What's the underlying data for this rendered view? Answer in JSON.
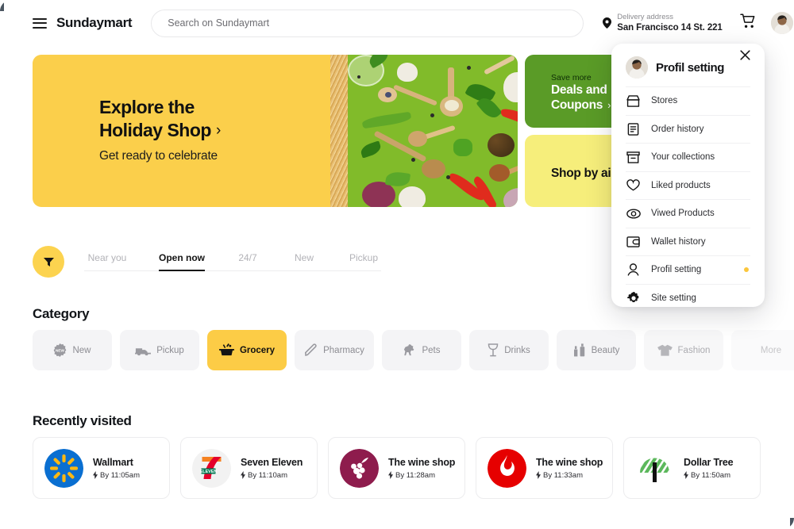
{
  "header": {
    "menu_icon": "hamburger-icon",
    "brand": "Sundaymart",
    "search": {
      "placeholder": "Search on Sundaymart",
      "value": ""
    },
    "delivery": {
      "label": "Delivery address",
      "value": "San Francisco 14 St. 221",
      "icon": "location-pin-icon"
    },
    "cart_icon": "shopping-cart-icon",
    "avatar": "user-avatar"
  },
  "hero": {
    "title_line1": "Explore the",
    "title_line2": "Holiday Shop",
    "chevron": "›",
    "subtitle": "Get ready to celebrate"
  },
  "promos": [
    {
      "small": "Save more",
      "big_line1": "Deals and",
      "big_line2": "Coupons",
      "chevron": "›",
      "color": "#5a9b27"
    },
    {
      "big_line1": "Shop by aisle",
      "chevron": "›",
      "color": "#f6ee7b"
    }
  ],
  "filters": {
    "filter_icon": "funnel-filter-icon",
    "tabs": [
      {
        "label": "Near you",
        "active": false
      },
      {
        "label": "Open now",
        "active": true
      },
      {
        "label": "24/7",
        "active": false
      },
      {
        "label": "New",
        "active": false
      },
      {
        "label": "Pickup",
        "active": false
      }
    ]
  },
  "category": {
    "title": "Category",
    "items": [
      {
        "label": "New",
        "icon": "new-badge-icon",
        "state": "normal"
      },
      {
        "label": "Pickup",
        "icon": "pickup-truck-icon",
        "state": "normal"
      },
      {
        "label": "Grocery",
        "icon": "grocery-basket-icon",
        "state": "active"
      },
      {
        "label": "Pharmacy",
        "icon": "pharmacy-pen-icon",
        "state": "normal"
      },
      {
        "label": "Pets",
        "icon": "pets-dog-icon",
        "state": "normal"
      },
      {
        "label": "Drinks",
        "icon": "drinks-glass-icon",
        "state": "normal"
      },
      {
        "label": "Beauty",
        "icon": "beauty-cosmetics-icon",
        "state": "normal"
      },
      {
        "label": "Fashion",
        "icon": "fashion-tshirt-icon",
        "state": "fade1"
      },
      {
        "label": "More",
        "icon": "",
        "state": "fade2"
      }
    ]
  },
  "recently_visited": {
    "title": "Recently visited",
    "items": [
      {
        "name": "Wallmart",
        "time": "By 11:05am",
        "logo": "walmart-logo"
      },
      {
        "name": "Seven Eleven",
        "time": "By 11:10am",
        "logo": "seven-eleven-logo"
      },
      {
        "name": "The wine shop",
        "time": "By 11:28am",
        "logo": "wine-shop-logo"
      },
      {
        "name": "The wine shop",
        "time": "By 11:33am",
        "logo": "vodafone-logo"
      },
      {
        "name": "Dollar Tree",
        "time": "By 11:50am",
        "logo": "dollar-tree-logo"
      }
    ]
  },
  "dropdown": {
    "title": "Profil setting",
    "avatar": "user-avatar",
    "close_icon": "close-icon",
    "items": [
      {
        "label": "Stores",
        "icon": "store-icon",
        "dot": false
      },
      {
        "label": "Order history",
        "icon": "document-list-icon",
        "dot": false
      },
      {
        "label": "Your collections",
        "icon": "archive-box-icon",
        "dot": false
      },
      {
        "label": "Liked products",
        "icon": "heart-icon",
        "dot": false
      },
      {
        "label": "Viwed Products",
        "icon": "eye-icon",
        "dot": false
      },
      {
        "label": "Wallet history",
        "icon": "wallet-icon",
        "dot": false
      },
      {
        "label": "Profil setting",
        "icon": "person-icon",
        "dot": true
      },
      {
        "label": "Site setting",
        "icon": "gear-icon",
        "dot": false
      }
    ]
  },
  "colors": {
    "accent_yellow": "#fccc46",
    "green": "#5a9b27",
    "pale_yellow": "#f6ee7b",
    "dot": "#fbc63c"
  }
}
